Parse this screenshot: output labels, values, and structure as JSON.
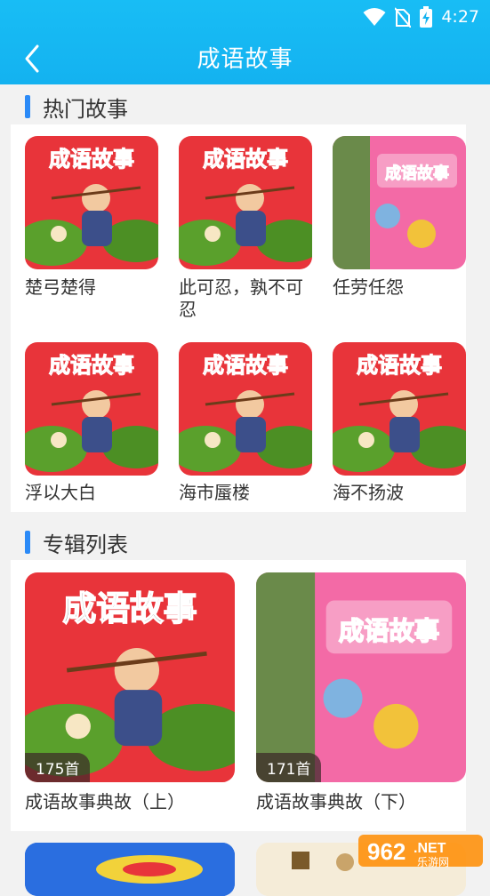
{
  "status_bar": {
    "time": "4:27"
  },
  "header": {
    "title": "成语故事"
  },
  "hot_section": {
    "heading": "热门故事",
    "items": [
      {
        "title": "楚弓楚得",
        "cover": "red-cover"
      },
      {
        "title": "此可忍，孰不可忍",
        "cover": "red-cover"
      },
      {
        "title": "任劳任怨",
        "cover": "pink-cover"
      },
      {
        "title": "浮以大白",
        "cover": "red-cover"
      },
      {
        "title": "海市蜃楼",
        "cover": "red-cover"
      },
      {
        "title": "海不扬波",
        "cover": "red-cover"
      }
    ]
  },
  "album_section": {
    "heading": "专辑列表",
    "items": [
      {
        "title": "成语故事典故（上）",
        "count": "175首",
        "cover": "red-cover"
      },
      {
        "title": "成语故事典故（下）",
        "count": "171首",
        "cover": "pink-cover"
      }
    ]
  },
  "cover_text": "成语故事",
  "watermark": {
    "number": "962",
    "suffix": ".NET",
    "sub": "乐游网"
  },
  "colors": {
    "header": "#14b2f0",
    "accent": "#2b8af7",
    "red_cover": "#e8343a",
    "pink_cover": "#f36aa6"
  }
}
